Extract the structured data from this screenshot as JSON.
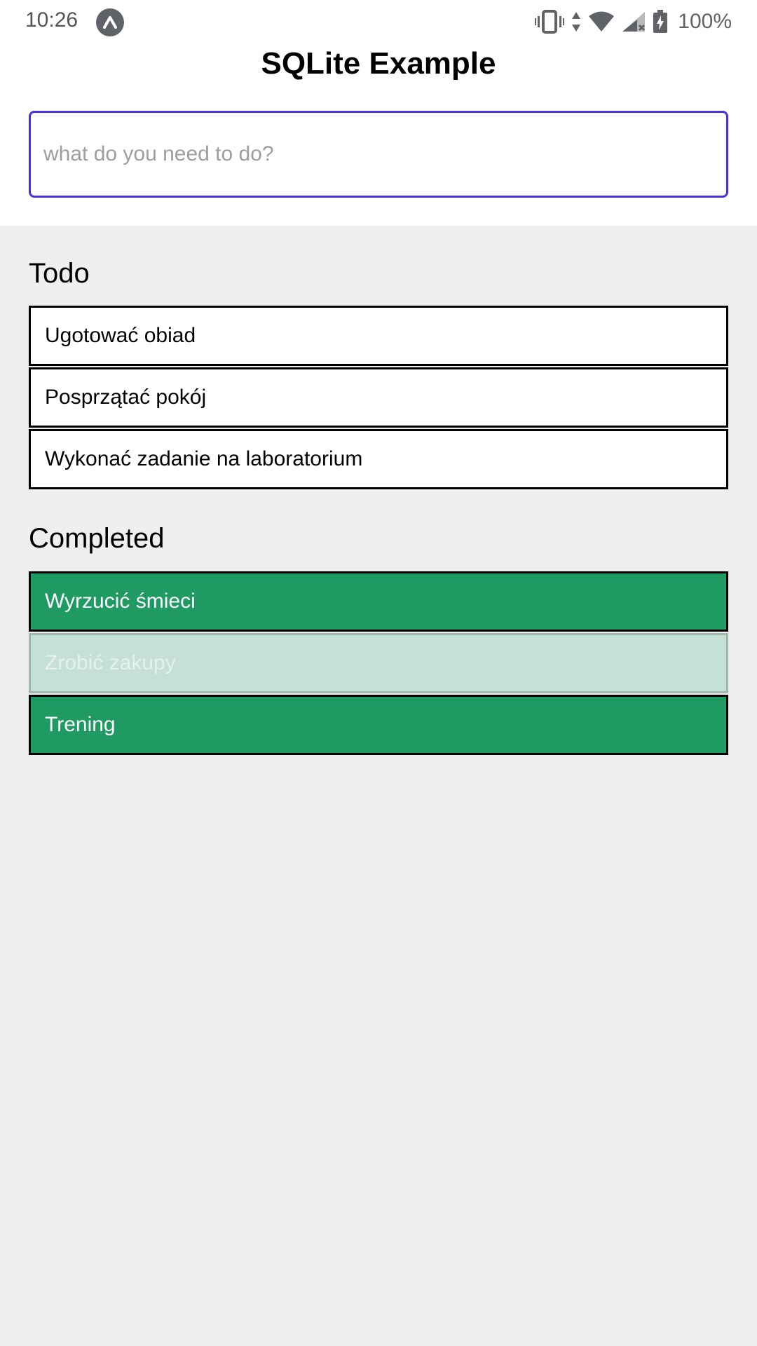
{
  "status_bar": {
    "time": "10:26",
    "battery": "100%"
  },
  "header": {
    "title": "SQLite Example"
  },
  "input": {
    "placeholder": "what do you need to do?",
    "value": ""
  },
  "todo": {
    "heading": "Todo",
    "items": [
      "Ugotować obiad",
      "Posprzątać pokój",
      "Wykonać zadanie na laboratorium"
    ]
  },
  "completed": {
    "heading": "Completed",
    "items": [
      "Wyrzucić śmieci",
      "Zrobić zakupy",
      "Trening"
    ]
  },
  "colors": {
    "accent": "#4433e0",
    "done": "#1e9a62",
    "done_faded": "#c5e1d5"
  }
}
